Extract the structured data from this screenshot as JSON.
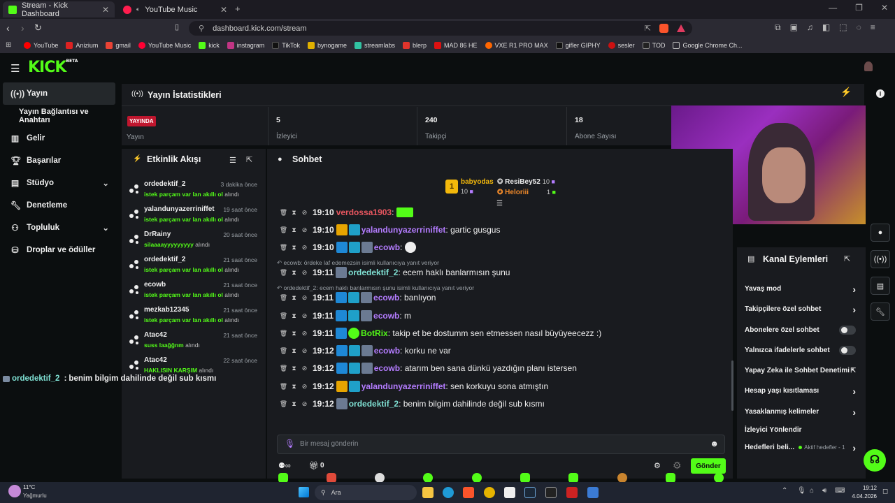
{
  "browser": {
    "tabs": [
      {
        "label": "Stream - Kick Dashboard",
        "active": true
      },
      {
        "label": "YouTube Music",
        "active": false
      }
    ],
    "url": "dashboard.kick.com/stream",
    "bookmarks": [
      "YouTube",
      "Anizium",
      "gmail",
      "YouTube Music",
      "kick",
      "instagram",
      "TikTok",
      "bynogame",
      "streamlabs",
      "blerp",
      "MAD 86 HE",
      "VXE R1 PRO MAX",
      "gifler GIPHY",
      "sesler",
      "TOD",
      "Google Chrome Ch..."
    ]
  },
  "brand": {
    "logo": "KICK",
    "beta": "BETA",
    "accent": "#53fc18"
  },
  "sidebar": {
    "items": [
      {
        "label": "Yayın",
        "icon": "broadcast-icon"
      },
      {
        "label": "Yayın Bağlantısı ve Anahtarı",
        "icon": ""
      },
      {
        "label": "Gelir",
        "icon": "chart-icon"
      },
      {
        "label": "Başarılar",
        "icon": "trophy-icon"
      },
      {
        "label": "Stüdyo",
        "icon": "studio-icon"
      },
      {
        "label": "Denetleme",
        "icon": "wrench-icon"
      },
      {
        "label": "Topluluk",
        "icon": "community-icon"
      },
      {
        "label": "Droplar ve ödüller",
        "icon": "drops-icon"
      }
    ]
  },
  "stats": {
    "title": "Yayın İstatistikleri",
    "live_badge": "YAYINDA",
    "live_label": "Yayın",
    "viewers": {
      "value": "5",
      "label": "İzleyici"
    },
    "followers": {
      "value": "240",
      "label": "Takipçi"
    },
    "subs": {
      "value": "18",
      "label": "Abone Sayısı"
    }
  },
  "activity": {
    "title": "Etkinlik Akışı",
    "events": [
      {
        "name": "ordedektif_2",
        "time": "3 dakika önce",
        "hl": "istek parçam var lan akıllı ol",
        "suffix": "alındı"
      },
      {
        "name": "yalandunyazerriniffet",
        "time": "19 saat önce",
        "hl": "istek parçam var lan akıllı ol",
        "suffix": "alındı"
      },
      {
        "name": "DrRainy",
        "time": "20 saat önce",
        "hl": "silaaaayyyyyyyyy",
        "suffix": "alındı"
      },
      {
        "name": "ordedektif_2",
        "time": "21 saat önce",
        "hl": "istek parçam var lan akıllı ol",
        "suffix": "alındı"
      },
      {
        "name": "ecowb",
        "time": "21 saat önce",
        "hl": "istek parçam var lan akıllı ol",
        "suffix": "alındı"
      },
      {
        "name": "mezkab12345",
        "time": "21 saat önce",
        "hl": "istek parçam var lan akıllı ol",
        "suffix": "alındı"
      },
      {
        "name": "Atac42",
        "time": "21 saat önce",
        "hl": "suss laağğnm",
        "suffix": "alındı"
      },
      {
        "name": "Atac42",
        "time": "22 saat önce",
        "hl": "HAKLISIN KARŞIM",
        "suffix": "alındı"
      }
    ]
  },
  "overlay": {
    "user": "ordedektif_2",
    "text": "benim bilgim dahilinde değil sub kısmı"
  },
  "chat": {
    "title": "Sohbet",
    "top": [
      {
        "name": "babyodas",
        "count": "10",
        "rank": "1"
      },
      {
        "name": "ResiBey52",
        "count": "10"
      },
      {
        "name": "Heloriii",
        "count": "1"
      }
    ],
    "messages": [
      {
        "time": "19:10",
        "user": "verdossa1903",
        "color": "#e8565f",
        "text": "",
        "reply": ""
      },
      {
        "time": "19:10",
        "user": "yalandunyazerriniffet",
        "color": "#b47cff",
        "text": "gartic gusgus",
        "reply": ""
      },
      {
        "time": "19:10",
        "user": "ecowb",
        "color": "#b47cff",
        "text": "",
        "reply": ""
      },
      {
        "time": "19:11",
        "user": "ordedektif_2",
        "color": "#7fe0d3",
        "text": "ecem haklı banlarmısın şunu",
        "reply": "ecowb: ördeke laf edemezsin isimli kullanıcıya yanıt veriyor"
      },
      {
        "time": "19:11",
        "user": "ecowb",
        "color": "#b47cff",
        "text": "banlıyon",
        "reply": "ordedektif_2: ecem haklı banlarmısın şunu isimli kullanıcıya yanıt veriyor"
      },
      {
        "time": "19:11",
        "user": "ecowb",
        "color": "#b47cff",
        "text": "m",
        "reply": ""
      },
      {
        "time": "19:11",
        "user": "BotRix",
        "color": "#53fc18",
        "text": "takip et be dostumm sen etmessen nasıl büyüyeecezz :)",
        "reply": ""
      },
      {
        "time": "19:12",
        "user": "ecowb",
        "color": "#b47cff",
        "text": "korku ne var",
        "reply": ""
      },
      {
        "time": "19:12",
        "user": "ecowb",
        "color": "#b47cff",
        "text": "atarım ben sana dünkü yazdığın planı istersen",
        "reply": ""
      },
      {
        "time": "19:12",
        "user": "yalandunyazerriniffet",
        "color": "#b47cff",
        "text": "sen korkuyu sona atmıştın",
        "reply": ""
      },
      {
        "time": "19:12",
        "user": "ordedektif_2",
        "color": "#7fe0d3",
        "text": "benim bilgim dahilinde değil sub kısmı",
        "reply": ""
      }
    ],
    "input_placeholder": "Bir mesaj gönderin",
    "points": "0",
    "send_label": "Gönder"
  },
  "channel_actions": {
    "title": "Kanal Eylemleri",
    "items": [
      {
        "label": "Yavaş mod",
        "control": "chevron"
      },
      {
        "label": "Takipçilere özel sohbet",
        "control": "chevron"
      },
      {
        "label": "Abonelere özel sohbet",
        "control": "toggle"
      },
      {
        "label": "Yalnızca ifadelerle sohbet",
        "control": "toggle"
      },
      {
        "label": "Yapay Zeka ile Sohbet Denetimi",
        "control": "external"
      },
      {
        "label": "Hesap yaşı kısıtlaması",
        "control": "chevron"
      },
      {
        "label": "Yasaklanmış kelimeler",
        "control": "chevron"
      },
      {
        "label": "İzleyici Yönlendir",
        "control": "none"
      },
      {
        "label": "Hedefleri beli...",
        "control": "chevron",
        "extra": "Aktif hedefler - 1"
      }
    ]
  },
  "taskbar": {
    "weather_temp": "11°C",
    "weather_desc": "Yağmurlu",
    "search": "Ara",
    "time": "19:12",
    "date": "4.04.2026"
  }
}
